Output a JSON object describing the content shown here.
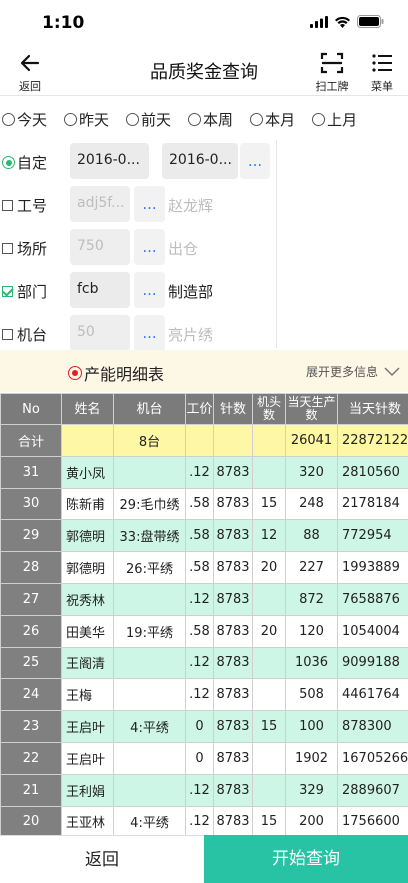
{
  "status": {
    "time": "1:10"
  },
  "nav": {
    "back_label": "返回",
    "title": "品质奖金查询",
    "scan_label": "扫工牌",
    "menu_label": "菜单"
  },
  "date_options": [
    "今天",
    "昨天",
    "前天",
    "本周",
    "本月",
    "上月"
  ],
  "custom": {
    "label": "自定",
    "start": "2016-0...",
    "end": "2016-0...",
    "dots": "..."
  },
  "filters": {
    "worker": {
      "label": "工号",
      "value": "adj5f...",
      "name": "赵龙辉",
      "checked": false
    },
    "site": {
      "label": "场所",
      "value": "750",
      "name": "出仓",
      "checked": false
    },
    "dept": {
      "label": "部门",
      "value": "fcb",
      "name": "制造部",
      "checked": true
    },
    "machine": {
      "label": "机台",
      "value": "50",
      "name": "亮片绣",
      "checked": false
    }
  },
  "detail": {
    "title": "产能明细表",
    "expand": "展开更多信息"
  },
  "table": {
    "headers": {
      "no": "No",
      "name": "姓名",
      "machine": "机台",
      "price": "工价",
      "stitches": "针数",
      "heads": "机头数",
      "output": "当天生产数",
      "total": "当天针数"
    },
    "total_row": {
      "no": "合计",
      "machine": "8台",
      "output": "26041",
      "total": "22872122"
    },
    "rows": [
      {
        "no": "31",
        "name": "黄小凤",
        "machine": "",
        "price": ".12",
        "stitches": "8783",
        "heads": "",
        "output": "320",
        "total": "2810560"
      },
      {
        "no": "30",
        "name": "陈新甫",
        "machine": "29:毛巾绣",
        "price": ".58",
        "stitches": "8783",
        "heads": "15",
        "output": "248",
        "total": "2178184"
      },
      {
        "no": "29",
        "name": "郭德明",
        "machine": "33:盘带绣",
        "price": ".58",
        "stitches": "8783",
        "heads": "12",
        "output": "88",
        "total": "772954"
      },
      {
        "no": "28",
        "name": "郭德明",
        "machine": "26:平绣",
        "price": ".58",
        "stitches": "8783",
        "heads": "20",
        "output": "227",
        "total": "1993889"
      },
      {
        "no": "27",
        "name": "祝秀林",
        "machine": "",
        "price": ".12",
        "stitches": "8783",
        "heads": "",
        "output": "872",
        "total": "7658876"
      },
      {
        "no": "26",
        "name": "田美华",
        "machine": "19:平绣",
        "price": ".58",
        "stitches": "8783",
        "heads": "20",
        "output": "120",
        "total": "1054004"
      },
      {
        "no": "25",
        "name": "王阁清",
        "machine": "",
        "price": ".12",
        "stitches": "8783",
        "heads": "",
        "output": "1036",
        "total": "9099188"
      },
      {
        "no": "24",
        "name": "王梅",
        "machine": "",
        "price": ".12",
        "stitches": "8783",
        "heads": "",
        "output": "508",
        "total": "4461764"
      },
      {
        "no": "23",
        "name": "王启叶",
        "machine": "4:平绣",
        "price": "0",
        "stitches": "8783",
        "heads": "15",
        "output": "100",
        "total": "878300"
      },
      {
        "no": "22",
        "name": "王启叶",
        "machine": "",
        "price": "0",
        "stitches": "8783",
        "heads": "",
        "output": "1902",
        "total": "16705266"
      },
      {
        "no": "21",
        "name": "王利娟",
        "machine": "",
        "price": ".12",
        "stitches": "8783",
        "heads": "",
        "output": "329",
        "total": "2889607"
      },
      {
        "no": "20",
        "name": "王亚林",
        "machine": "4:平绣",
        "price": ".12",
        "stitches": "8783",
        "heads": "15",
        "output": "200",
        "total": "1756600"
      }
    ]
  },
  "bottom": {
    "back": "返回",
    "query": "开始查询"
  },
  "colors": {
    "accent": "#28c2a5",
    "stripe": "#cdf6e6",
    "total": "#fdf7a6",
    "header": "#7b7b7b"
  }
}
